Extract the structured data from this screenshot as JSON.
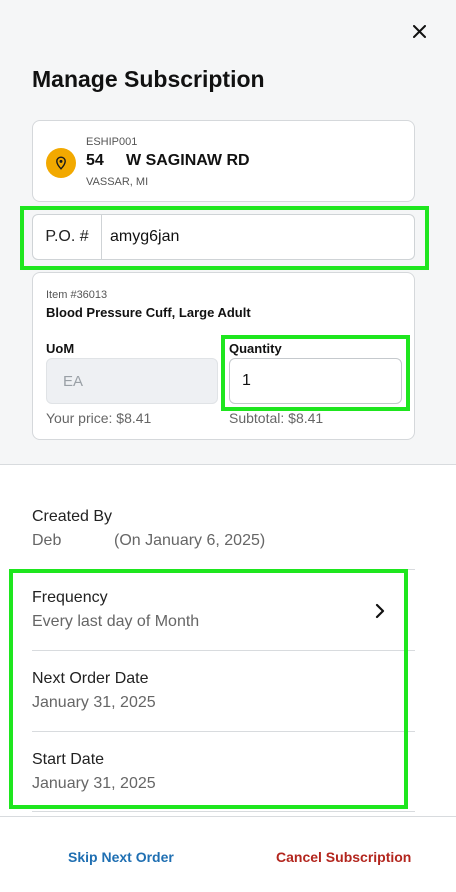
{
  "header": {
    "title": "Manage Subscription",
    "close_icon": "close-icon"
  },
  "address": {
    "code": "ESHIP001",
    "street": "54     W SAGINAW RD",
    "city": "VASSAR, MI",
    "icon": "location-pin-icon",
    "icon_color": "#f2a900"
  },
  "po": {
    "label": "P.O. #",
    "value": "amyg6jan"
  },
  "item": {
    "number": "Item #36013",
    "name": "Blood Pressure Cuff, Large Adult",
    "uom_label": "UoM",
    "uom_value": "EA",
    "quantity_label": "Quantity",
    "quantity_value": "1",
    "your_price": "Your price: $8.41",
    "subtotal": "Subtotal: $8.41"
  },
  "created": {
    "label": "Created By",
    "by": "Deb",
    "on": "(On January 6, 2025)"
  },
  "frequency": {
    "label": "Frequency",
    "value": "Every last day of Month",
    "icon": "chevron-right-icon"
  },
  "next_order": {
    "label": "Next Order Date",
    "value": "January 31, 2025"
  },
  "start_date": {
    "label": "Start Date",
    "value": "January 31, 2025"
  },
  "footer": {
    "skip_label": "Skip Next Order",
    "cancel_label": "Cancel Subscription"
  },
  "colors": {
    "skip": "#1f6fb2",
    "cancel": "#b3261e",
    "highlight": "#1ee61e"
  }
}
